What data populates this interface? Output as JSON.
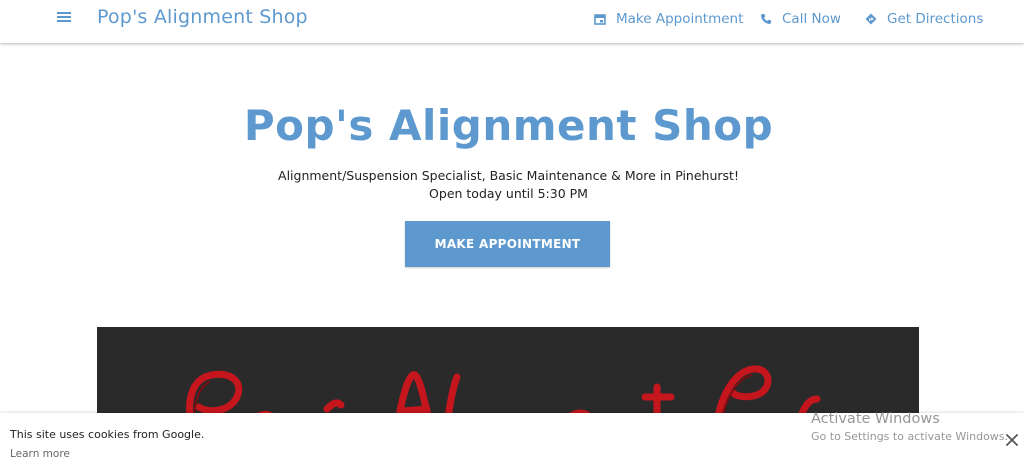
{
  "header": {
    "menu_icon": "hamburger-menu-icon",
    "site_name": "Pop's Alignment Shop",
    "nav": [
      {
        "label": "Make Appointment",
        "icon": "calendar-icon"
      },
      {
        "label": "Call Now",
        "icon": "phone-icon"
      },
      {
        "label": "Get Directions",
        "icon": "directions-icon"
      }
    ]
  },
  "hero": {
    "title": "Pop's Alignment Shop",
    "subtitle": "Alignment/Suspension Specialist, Basic Maintenance & More in Pinehurst!",
    "hours": "Open today until 5:30 PM",
    "cta_label": "MAKE APPOINTMENT"
  },
  "banner": {
    "background": "#2a2a2a",
    "script_color": "#c4161c"
  },
  "cookie_bar": {
    "text": "This site uses cookies from Google.",
    "learn_more": "Learn more",
    "close_icon": "close-icon"
  },
  "watermark": {
    "title": "Activate Windows",
    "subtitle": "Go to Settings to activate Windows."
  },
  "colors": {
    "accent": "#5d99cf",
    "text": "#222222"
  }
}
